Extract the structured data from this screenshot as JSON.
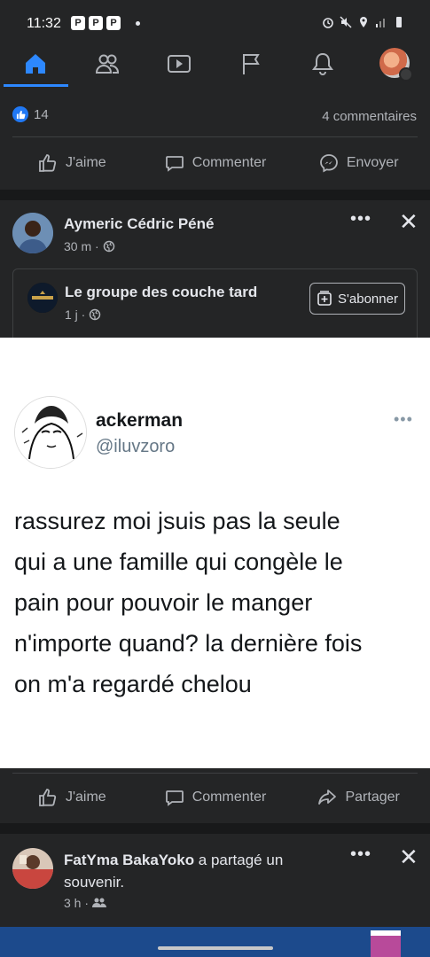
{
  "status_bar": {
    "time": "11:32",
    "app_icons": [
      "P",
      "P",
      "P"
    ]
  },
  "nav": {
    "items": [
      "home-icon",
      "friends-icon",
      "watch-icon",
      "pages-icon",
      "notifications-icon",
      "menu-icon"
    ],
    "active": "home",
    "accent_color": "#2d88ff"
  },
  "prev_post": {
    "likes": "14",
    "comments": "4 commentaires",
    "actions": {
      "like": "J'aime",
      "comment": "Commenter",
      "send": "Envoyer"
    }
  },
  "post": {
    "author": "Aymeric Cédric Péné",
    "time": "30 m ·",
    "more_label": "•••",
    "close_label": "✕",
    "shared_group": {
      "name": "Le groupe des couche tard",
      "time": "1 j ·",
      "subscribe_label": "S'abonner"
    },
    "tweet": {
      "name": "ackerman",
      "handle": "@iluvzoro",
      "more": "•••",
      "lines": [
        "rassurez moi jsuis pas la seule",
        "qui a une famille qui congèle le",
        "pain pour pouvoir le manger",
        "n'importe quand? la dernière fois",
        "on m'a regardé chelou"
      ]
    },
    "actions": {
      "like": "J'aime",
      "comment": "Commenter",
      "share": "Partager"
    }
  },
  "next_post": {
    "author": "FatYma BakaYoko",
    "action_text": " a partagé un",
    "action_text2": "souvenir.",
    "time": "3 h ·",
    "more_label": "•••",
    "close_label": "✕"
  }
}
